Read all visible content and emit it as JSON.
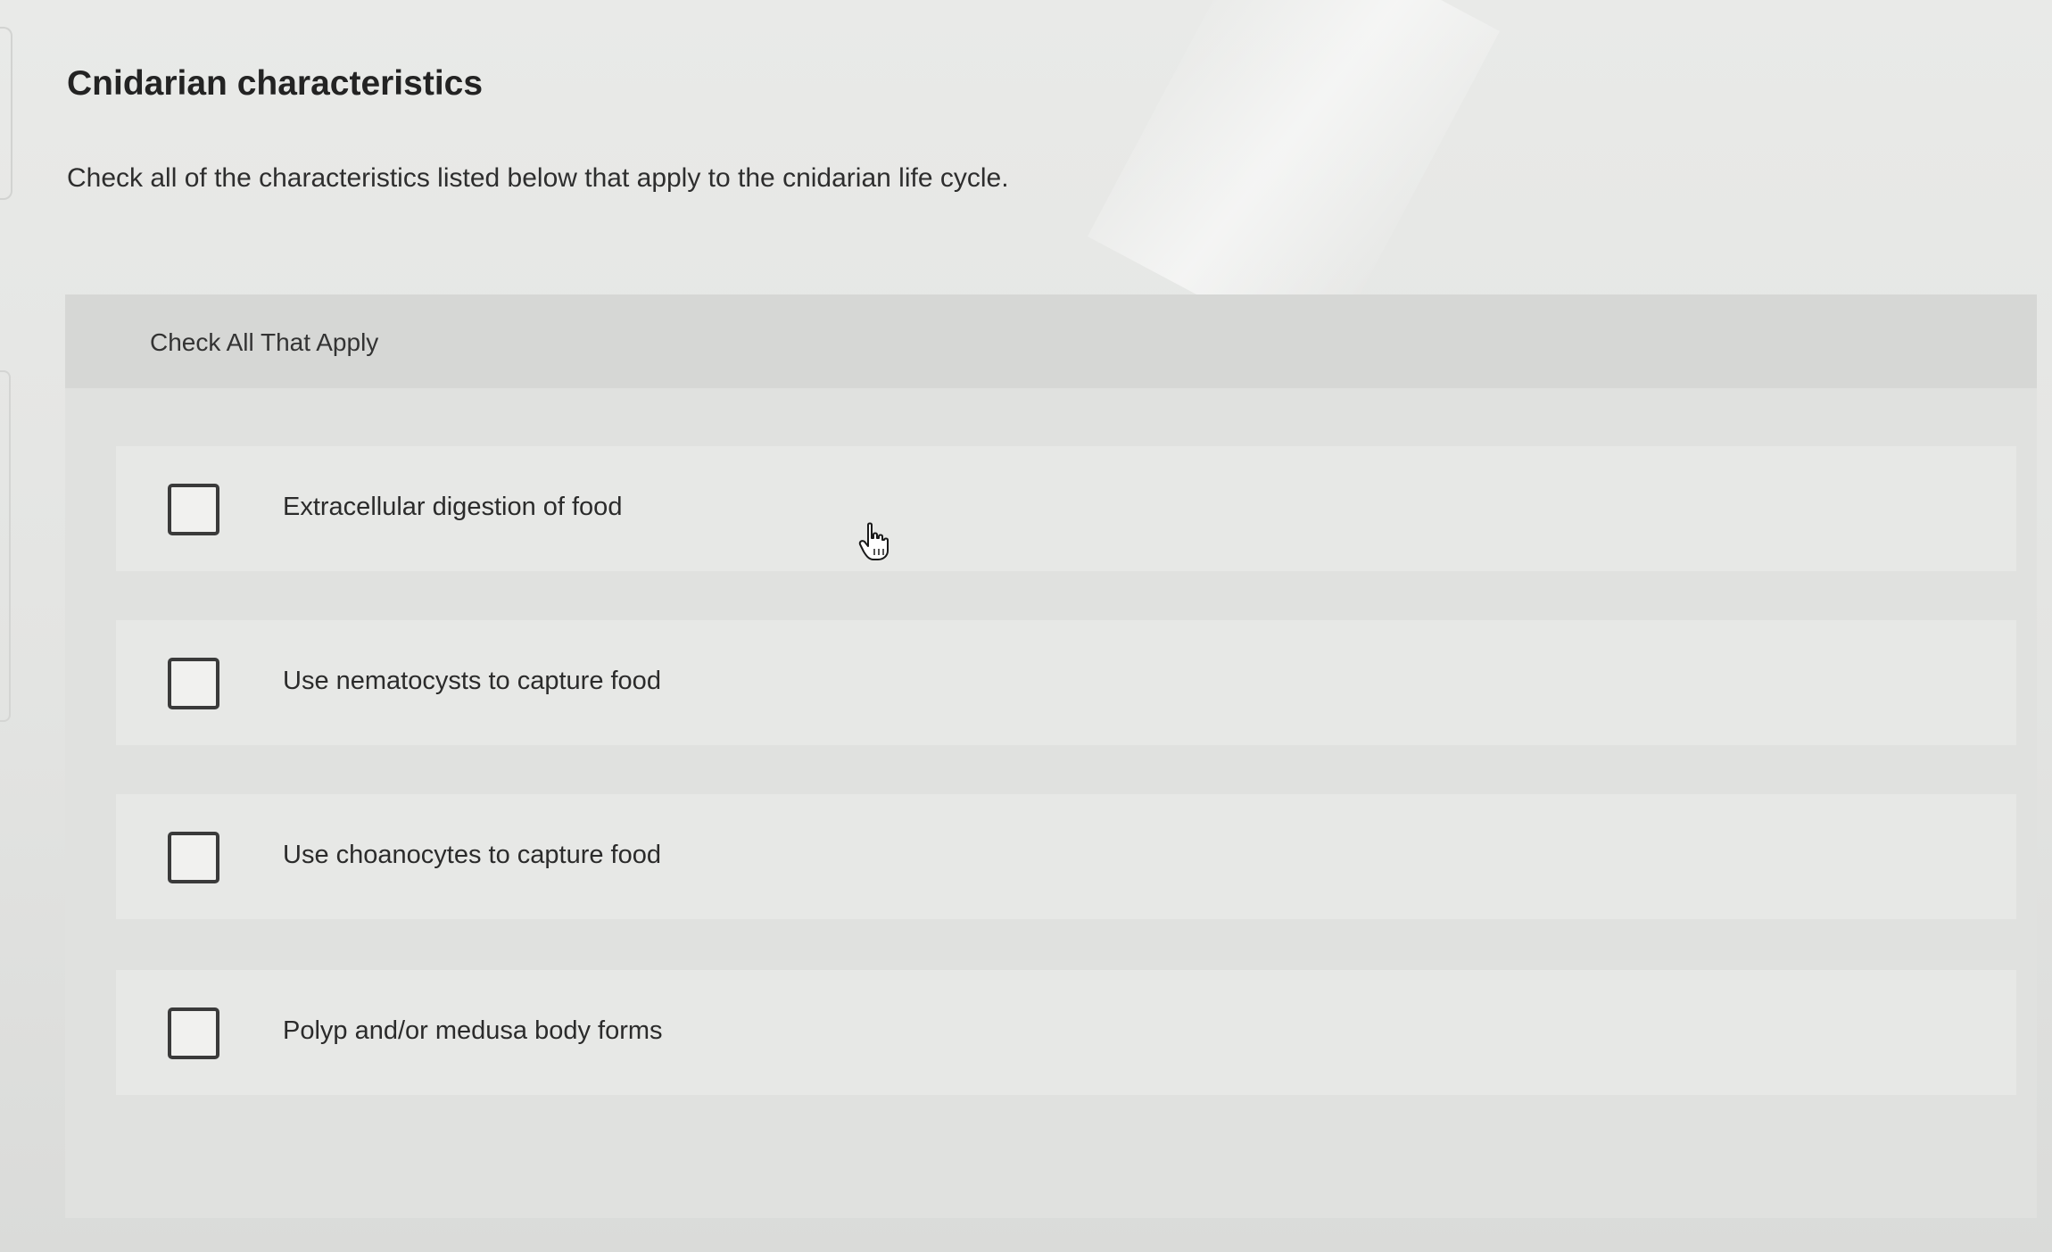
{
  "header": {
    "title": "Cnidarian characteristics",
    "instructions": "Check all of the characteristics listed below that apply to the cnidarian life cycle."
  },
  "question": {
    "prompt": "Check All That Apply",
    "options": [
      {
        "label": "Extracellular digestion of food",
        "checked": false
      },
      {
        "label": "Use nematocysts to capture food",
        "checked": false
      },
      {
        "label": "Use choanocytes to capture food",
        "checked": false
      },
      {
        "label": "Polyp and/or medusa body forms",
        "checked": false
      }
    ]
  },
  "icons": {
    "cursor": "hand-pointer-icon"
  },
  "colors": {
    "checkbox_border": "#3a3a3a",
    "panel_background": "#e0e1df",
    "header_background": "#d6d7d5"
  }
}
